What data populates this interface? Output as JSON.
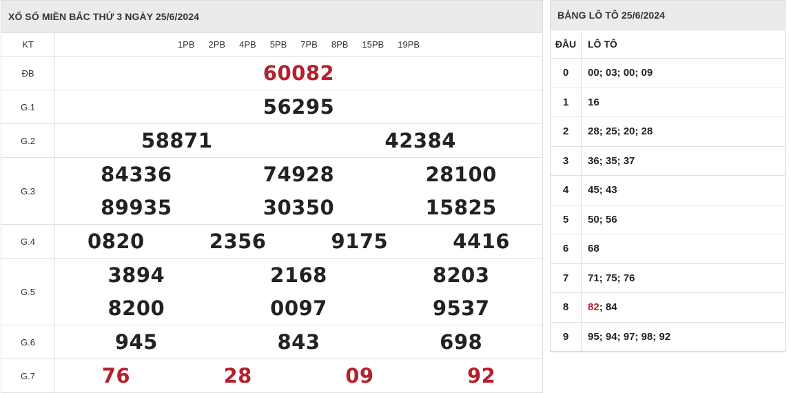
{
  "results": {
    "title": "XỔ SỐ MIỀN BẮC THỨ 3 NGÀY 25/6/2024",
    "kt_label": "KT",
    "pb_codes": [
      "1PB",
      "2PB",
      "4PB",
      "5PB",
      "7PB",
      "8PB",
      "15PB",
      "19PB"
    ],
    "prizes": [
      {
        "label": "ĐB",
        "rows": [
          [
            "60082"
          ]
        ],
        "red": true
      },
      {
        "label": "G.1",
        "rows": [
          [
            "56295"
          ]
        ],
        "red": false
      },
      {
        "label": "G.2",
        "rows": [
          [
            "58871",
            "42384"
          ]
        ],
        "red": false
      },
      {
        "label": "G.3",
        "rows": [
          [
            "84336",
            "74928",
            "28100"
          ],
          [
            "89935",
            "30350",
            "15825"
          ]
        ],
        "red": false
      },
      {
        "label": "G.4",
        "rows": [
          [
            "0820",
            "2356",
            "9175",
            "4416"
          ]
        ],
        "red": false
      },
      {
        "label": "G.5",
        "rows": [
          [
            "3894",
            "2168",
            "8203"
          ],
          [
            "8200",
            "0097",
            "9537"
          ]
        ],
        "red": false
      },
      {
        "label": "G.6",
        "rows": [
          [
            "945",
            "843",
            "698"
          ]
        ],
        "red": false
      },
      {
        "label": "G.7",
        "rows": [
          [
            "76",
            "28",
            "09",
            "92"
          ]
        ],
        "red": true
      }
    ]
  },
  "loto": {
    "title": "BẢNG LÔ TÔ 25/6/2024",
    "col_head": "ĐẦU",
    "col_loto": "LÔ TÔ",
    "rows": [
      {
        "head": "0",
        "pre": "",
        "hl": "",
        "post": "00; 03; 00; 09"
      },
      {
        "head": "1",
        "pre": "",
        "hl": "",
        "post": "16"
      },
      {
        "head": "2",
        "pre": "",
        "hl": "",
        "post": "28; 25; 20; 28"
      },
      {
        "head": "3",
        "pre": "",
        "hl": "",
        "post": "36; 35; 37"
      },
      {
        "head": "4",
        "pre": "",
        "hl": "",
        "post": "45; 43"
      },
      {
        "head": "5",
        "pre": "",
        "hl": "",
        "post": "50; 56"
      },
      {
        "head": "6",
        "pre": "",
        "hl": "",
        "post": "68"
      },
      {
        "head": "7",
        "pre": "",
        "hl": "",
        "post": "71; 75; 76"
      },
      {
        "head": "8",
        "pre": "",
        "hl": "82",
        "post": "; 84"
      },
      {
        "head": "9",
        "pre": "",
        "hl": "",
        "post": "95; 94; 97; 98; 92"
      }
    ],
    "highlight_color": "#b5202e"
  }
}
